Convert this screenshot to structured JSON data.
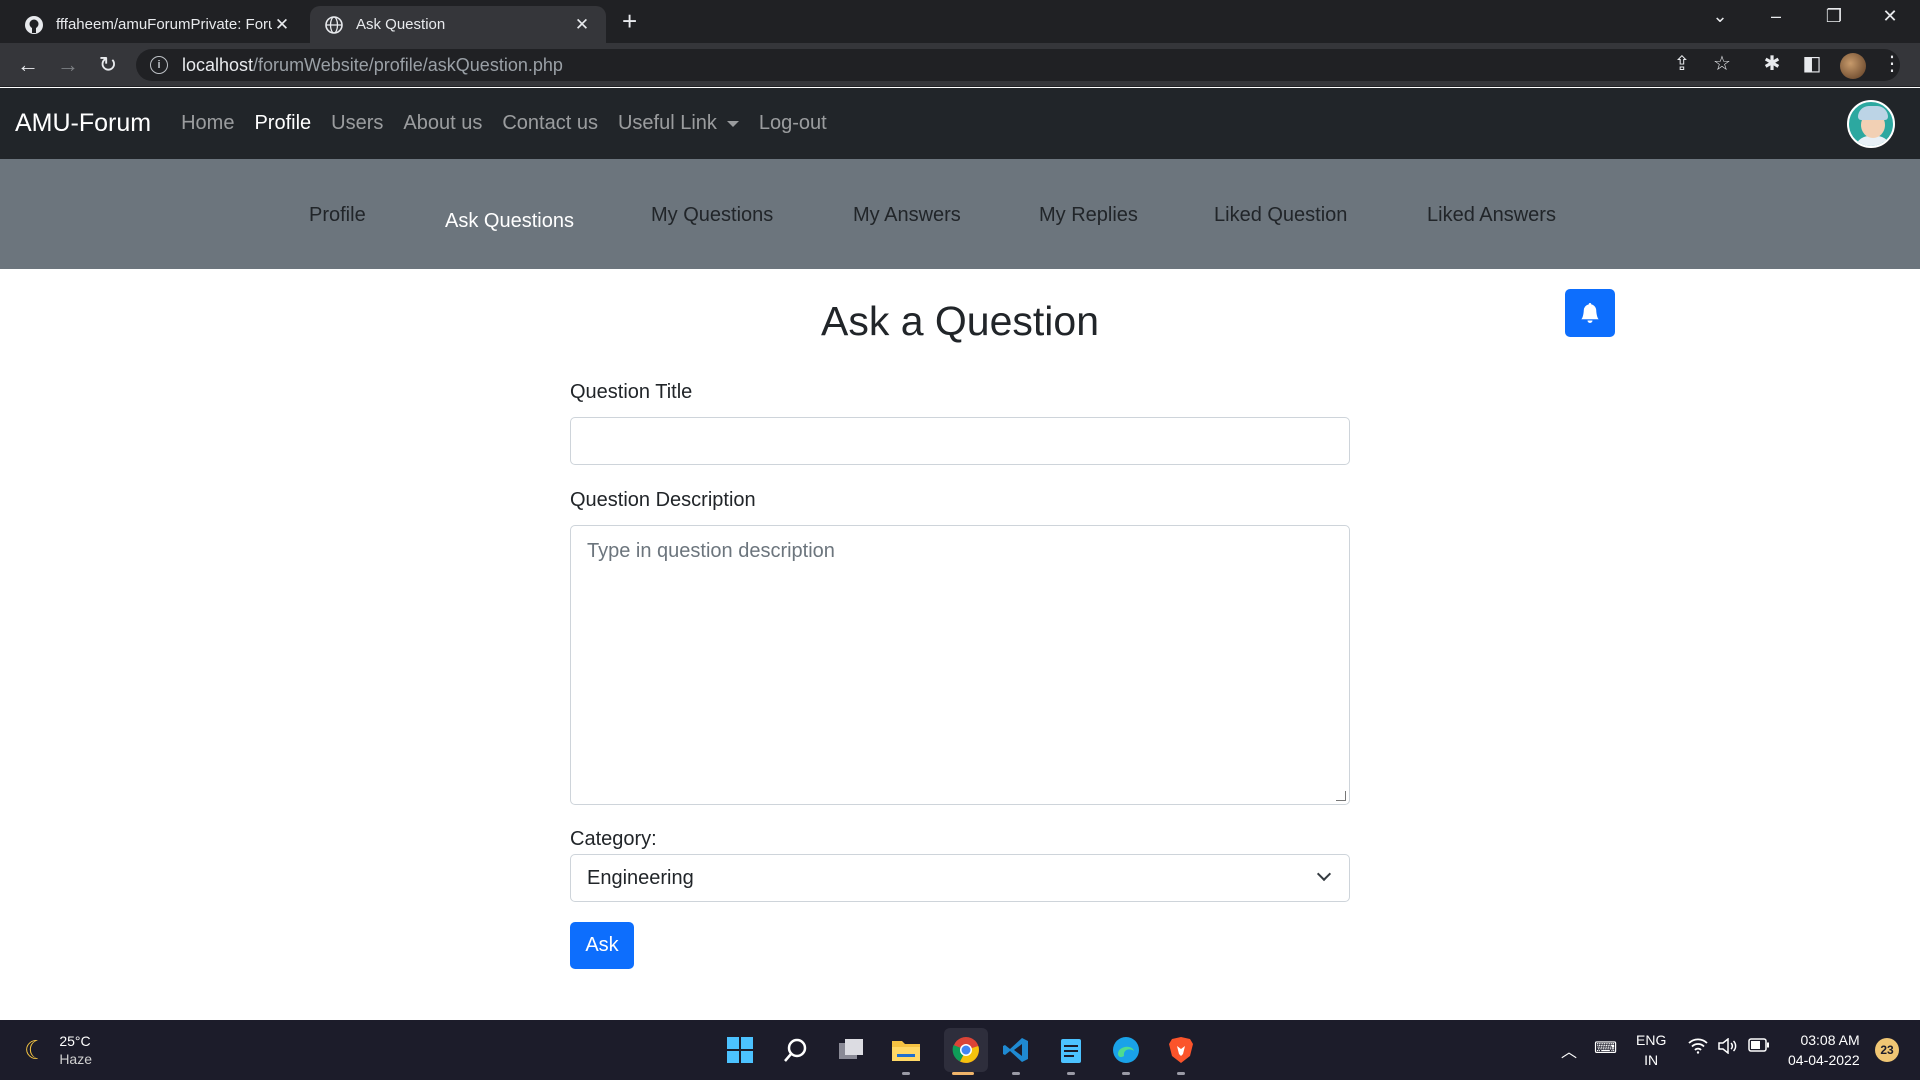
{
  "browser": {
    "tabs": [
      {
        "title": "fffaheem/amuForumPrivate: Foru",
        "icon": "github-icon"
      },
      {
        "title": "Ask Question",
        "icon": "globe-icon"
      }
    ],
    "url_host": "localhost",
    "url_path": "/forumWebsite/profile/askQuestion.php"
  },
  "navbar": {
    "brand": "AMU-Forum",
    "links": [
      {
        "label": "Home",
        "active": false
      },
      {
        "label": "Profile",
        "active": true
      },
      {
        "label": "Users",
        "active": false
      },
      {
        "label": "About us",
        "active": false
      },
      {
        "label": "Contact us",
        "active": false
      },
      {
        "label": "Useful Link",
        "active": false,
        "dropdown": true
      },
      {
        "label": "Log-out",
        "active": false
      }
    ]
  },
  "subnav": {
    "items": [
      {
        "label": "Profile",
        "active": false
      },
      {
        "label": "Ask Questions",
        "active": true
      },
      {
        "label": "My Questions",
        "active": false
      },
      {
        "label": "My Answers",
        "active": false
      },
      {
        "label": "My Replies",
        "active": false
      },
      {
        "label": "Liked Question",
        "active": false
      },
      {
        "label": "Liked Answers",
        "active": false
      }
    ]
  },
  "form": {
    "title": "Ask a Question",
    "question_title_label": "Question Title",
    "question_title_value": "",
    "description_label": "Question Description",
    "description_placeholder": "Type in question description",
    "category_label": "Category:",
    "category_selected": "Engineering",
    "submit_label": "Ask"
  },
  "taskbar": {
    "weather_temp": "25°C",
    "weather_desc": "Haze",
    "lang_line1": "ENG",
    "lang_line2": "IN",
    "time": "03:08 AM",
    "date": "04-04-2022",
    "notification_count": "23"
  },
  "colors": {
    "primary": "#0d6efd",
    "navbar_bg": "#212529",
    "subnav_bg": "#6c757d"
  }
}
